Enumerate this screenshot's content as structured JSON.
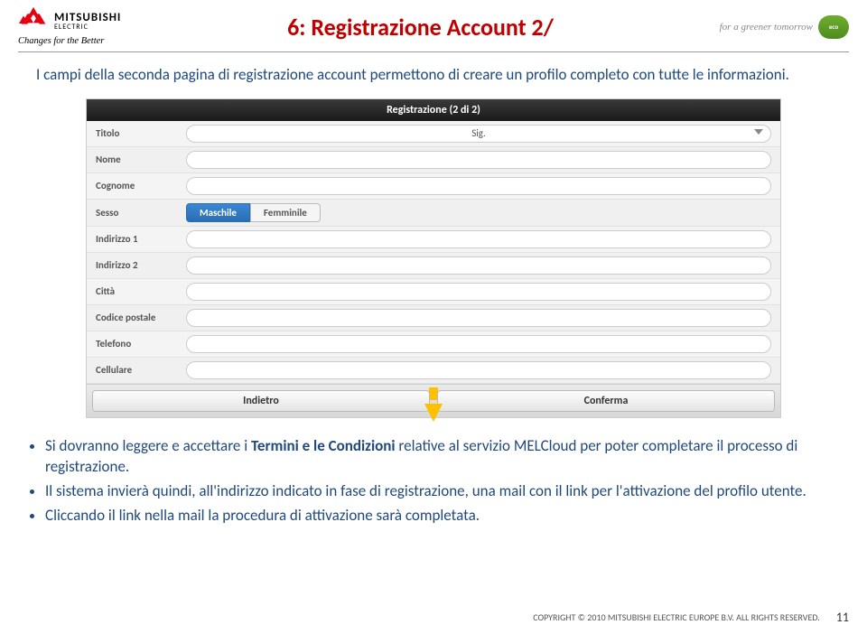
{
  "brand": {
    "name": "MITSUBISHI",
    "sub": "ELECTRIC",
    "tagline": "Changes for the Better"
  },
  "eco": {
    "text": "for a greener tomorrow",
    "badge": "eco"
  },
  "title": "6: Registrazione Account 2/",
  "intro": "I campi della seconda pagina di registrazione account permettono di creare un profilo completo con tutte le informazioni.",
  "form": {
    "header": "Registrazione (2 di 2)",
    "rows": {
      "titolo": {
        "label": "Titolo",
        "value": "Sig."
      },
      "nome": {
        "label": "Nome"
      },
      "cognome": {
        "label": "Cognome"
      },
      "sesso": {
        "label": "Sesso",
        "opt1": "Maschile",
        "opt2": "Femminile"
      },
      "indirizzo1": {
        "label": "Indirizzo 1"
      },
      "indirizzo2": {
        "label": "Indirizzo 2"
      },
      "citta": {
        "label": "Città"
      },
      "cap": {
        "label": "Codice postale"
      },
      "telefono": {
        "label": "Telefono"
      },
      "cellulare": {
        "label": "Cellulare"
      }
    },
    "buttons": {
      "back": "Indietro",
      "confirm": "Conferma"
    }
  },
  "bullets": {
    "b1a": "Si dovranno leggere e accettare i ",
    "b1b": "Termini e le Condizioni",
    "b1c": " relative al servizio MELCloud per poter completare il processo di registrazione.",
    "b2": "Il sistema invierà quindi, all'indirizzo indicato in fase di registrazione, una mail con il link per l'attivazione del profilo utente.",
    "b3": "Cliccando il link nella mail la procedura di attivazione sarà completata."
  },
  "footer": {
    "copyright": "COPYRIGHT © 2010 MITSUBISHI ELECTRIC EUROPE B.V. ALL RIGHTS RESERVED.",
    "page": "11"
  }
}
